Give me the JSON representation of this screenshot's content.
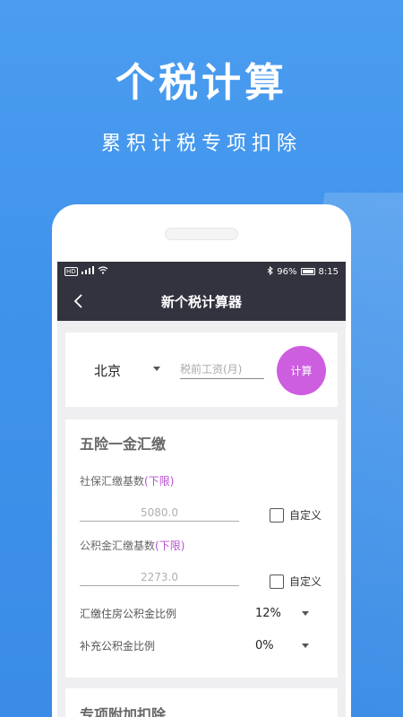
{
  "hero": {
    "title": "个税计算",
    "subtitle": "累积计税专项扣除"
  },
  "statusbar": {
    "left_icons": "HD ⁴ᴳ",
    "battery": "96%",
    "time": "8:15"
  },
  "appbar": {
    "title": "新个税计算器"
  },
  "calc": {
    "city": "北京",
    "salary_placeholder": "税前工资(月)",
    "button_label": "计算"
  },
  "insurance": {
    "title": "五险一金汇缴",
    "social_label": "社保汇缴基数",
    "social_hint": "(下限)",
    "social_value": "5080.0",
    "fund_label": "公积金汇缴基数",
    "fund_hint": "(下限)",
    "fund_value": "2273.0",
    "custom_label": "自定义",
    "housing_ratio_label": "汇缴住房公积金比例",
    "housing_ratio_value": "12%",
    "extra_ratio_label": "补充公积金比例",
    "extra_ratio_value": "0%"
  },
  "special": {
    "title": "专项附加扣除"
  }
}
